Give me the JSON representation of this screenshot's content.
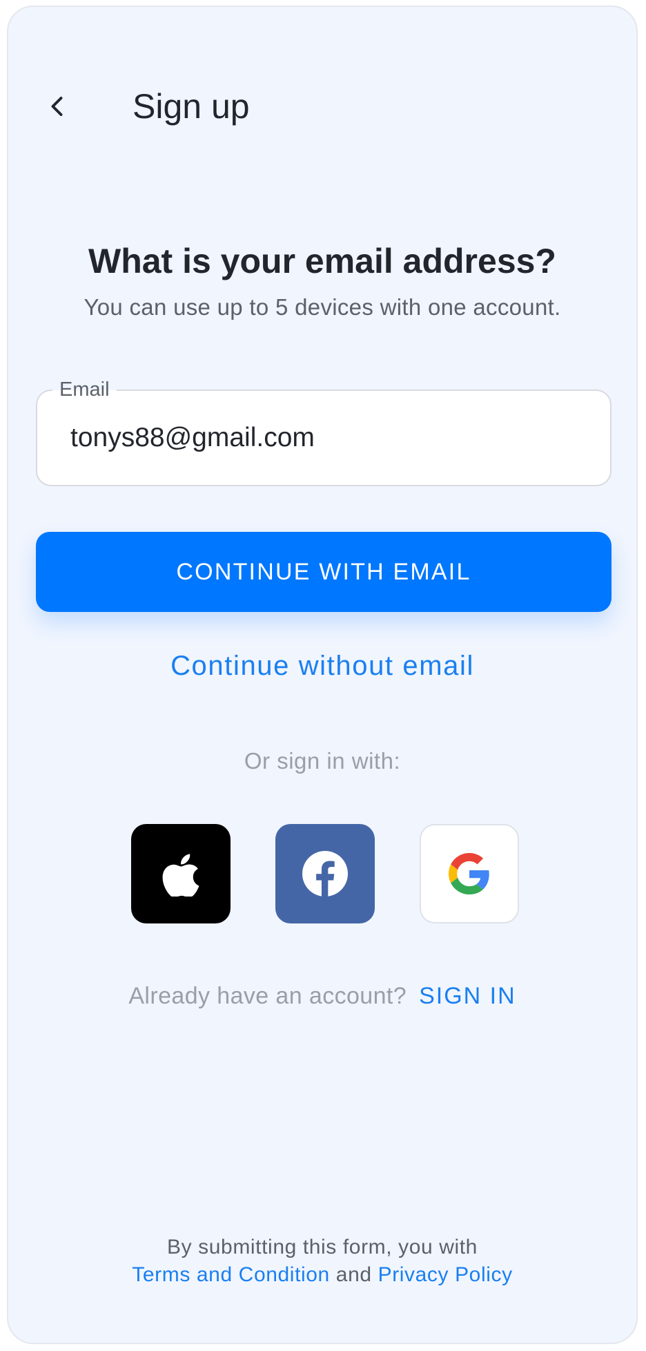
{
  "header": {
    "title": "Sign up",
    "back_icon": "chevron-left-icon"
  },
  "main": {
    "heading": "What is your email address?",
    "subheading": "You can use up to 5 devices with one account.",
    "email_field": {
      "label": "Email",
      "value": "tonys88@gmail.com"
    },
    "continue_button": "CONTINUE WITH EMAIL",
    "continue_without": "Continue without email",
    "or_sign_in": "Or sign in with:",
    "social_buttons": [
      {
        "name": "apple-icon",
        "color": "#000000"
      },
      {
        "name": "facebook-icon",
        "color": "#4566A6"
      },
      {
        "name": "google-icon",
        "color": "#FFFFFF"
      }
    ],
    "already_account": "Already have an account?",
    "sign_in_link": "SIGN IN"
  },
  "footer": {
    "line1": "By submitting this form, you with",
    "terms_link": "Terms and Condition",
    "and_text": "and",
    "privacy_link": "Privacy Policy"
  },
  "colors": {
    "accent": "#0077FF",
    "background": "#F0F5FE",
    "text_primary": "#23252C"
  }
}
